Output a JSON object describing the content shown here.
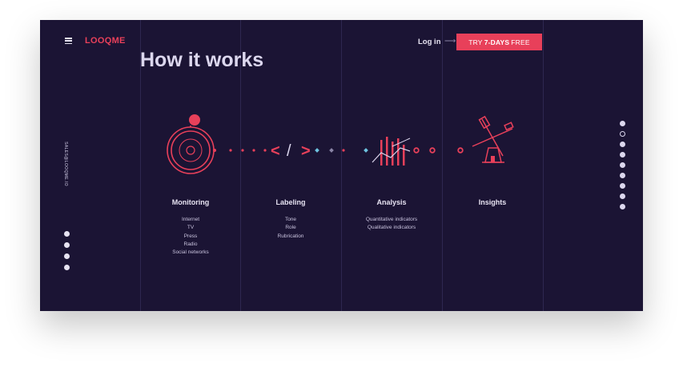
{
  "brand": {
    "logo": "LOOQME",
    "accent": "#e8405a",
    "background": "#1b1434"
  },
  "header": {
    "login_label": "Log in",
    "cta_prefix": "TRY",
    "cta_bold": "7-DAYS",
    "cta_suffix": "FREE"
  },
  "page_title": "How it works",
  "sidebar": {
    "email": "SALES@LOOQME.IO",
    "social_icons": [
      "facebook-icon",
      "twitter-icon",
      "instagram-icon",
      "youtube-icon"
    ]
  },
  "steps": [
    {
      "title": "Monitoring",
      "items": [
        "Internet",
        "TV",
        "Press",
        "Radio",
        "Social networks"
      ]
    },
    {
      "title": "Labeling",
      "items": [
        "Tone",
        "Role",
        "Rubrication"
      ]
    },
    {
      "title": "Analysis",
      "items": [
        "Quantitative indicators",
        "Qualitative indicators"
      ]
    },
    {
      "title": "Insights",
      "items": []
    }
  ],
  "labeling_glyphs": {
    "left": "<",
    "slash": "/",
    "right": ">"
  },
  "section_nav": {
    "count": 9,
    "active_index": 1
  }
}
